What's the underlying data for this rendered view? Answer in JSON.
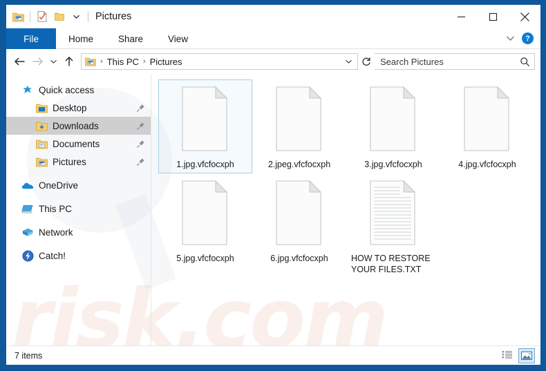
{
  "window": {
    "title": "Pictures",
    "border_color": "#10589c",
    "accent_color": "#0c66b5"
  },
  "quick_access_toolbar": {
    "items": [
      {
        "name": "explorer-icon",
        "label": "Explorer"
      },
      {
        "name": "properties-icon",
        "label": "Properties"
      },
      {
        "name": "new-folder-icon",
        "label": "New folder"
      },
      {
        "name": "customize-dropdown-icon",
        "label": "Customize Quick Access Toolbar"
      }
    ]
  },
  "window_controls": {
    "minimize": "Minimize",
    "maximize": "Maximize",
    "close": "Close"
  },
  "ribbon": {
    "tabs": [
      {
        "label": "File",
        "active": true
      },
      {
        "label": "Home",
        "active": false
      },
      {
        "label": "Share",
        "active": false
      },
      {
        "label": "View",
        "active": false
      }
    ],
    "collapse_label": "Minimize the Ribbon",
    "help_label": "?"
  },
  "address_bar": {
    "back_label": "Back",
    "forward_label": "Forward",
    "recent_label": "Recent locations",
    "up_label": "Up",
    "breadcrumbs": [
      "This PC",
      "Pictures"
    ],
    "separator": "›",
    "dropdown_label": "Previous locations",
    "refresh_label": "Refresh"
  },
  "search": {
    "placeholder": "Search Pictures"
  },
  "sidebar": {
    "items": [
      {
        "label": "Quick access",
        "icon": "star-icon",
        "indent": 0,
        "pinned": false,
        "selected": false
      },
      {
        "label": "Desktop",
        "icon": "folder-desktop-icon",
        "indent": 1,
        "pinned": true,
        "selected": false
      },
      {
        "label": "Downloads",
        "icon": "folder-downloads-icon",
        "indent": 1,
        "pinned": true,
        "selected": true
      },
      {
        "label": "Documents",
        "icon": "folder-documents-icon",
        "indent": 1,
        "pinned": true,
        "selected": false
      },
      {
        "label": "Pictures",
        "icon": "folder-pictures-icon",
        "indent": 1,
        "pinned": true,
        "selected": false
      },
      {
        "label": "OneDrive",
        "icon": "onedrive-cloud-icon",
        "indent": 0,
        "pinned": false,
        "selected": false,
        "gap_before": true
      },
      {
        "label": "This PC",
        "icon": "this-pc-icon",
        "indent": 0,
        "pinned": false,
        "selected": false,
        "gap_before": true
      },
      {
        "label": "Network",
        "icon": "network-icon",
        "indent": 0,
        "pinned": false,
        "selected": false,
        "gap_before": true
      },
      {
        "label": "Catch!",
        "icon": "catch-icon",
        "indent": 0,
        "pinned": false,
        "selected": false,
        "gap_before": true
      }
    ]
  },
  "files": [
    {
      "name": "1.jpg.vfcfocxph",
      "icon": "blank-file-icon",
      "selected": true,
      "wrap": false
    },
    {
      "name": "2.jpeg.vfcfocxph",
      "icon": "blank-file-icon",
      "selected": false,
      "wrap": false
    },
    {
      "name": "3.jpg.vfcfocxph",
      "icon": "blank-file-icon",
      "selected": false,
      "wrap": false
    },
    {
      "name": "4.jpg.vfcfocxph",
      "icon": "blank-file-icon",
      "selected": false,
      "wrap": false
    },
    {
      "name": "5.jpg.vfcfocxph",
      "icon": "blank-file-icon",
      "selected": false,
      "wrap": false
    },
    {
      "name": "6.jpg.vfcfocxph",
      "icon": "blank-file-icon",
      "selected": false,
      "wrap": false
    },
    {
      "name": "HOW TO RESTORE YOUR FILES.TXT",
      "icon": "text-file-icon",
      "selected": false,
      "wrap": true
    }
  ],
  "status_bar": {
    "item_count_text": "7 items",
    "views": [
      {
        "name": "details-view-button",
        "label": "Details view",
        "active": false
      },
      {
        "name": "large-icons-view-button",
        "label": "Large icons view",
        "active": true
      }
    ]
  },
  "watermark": {
    "text": "risk.com"
  }
}
